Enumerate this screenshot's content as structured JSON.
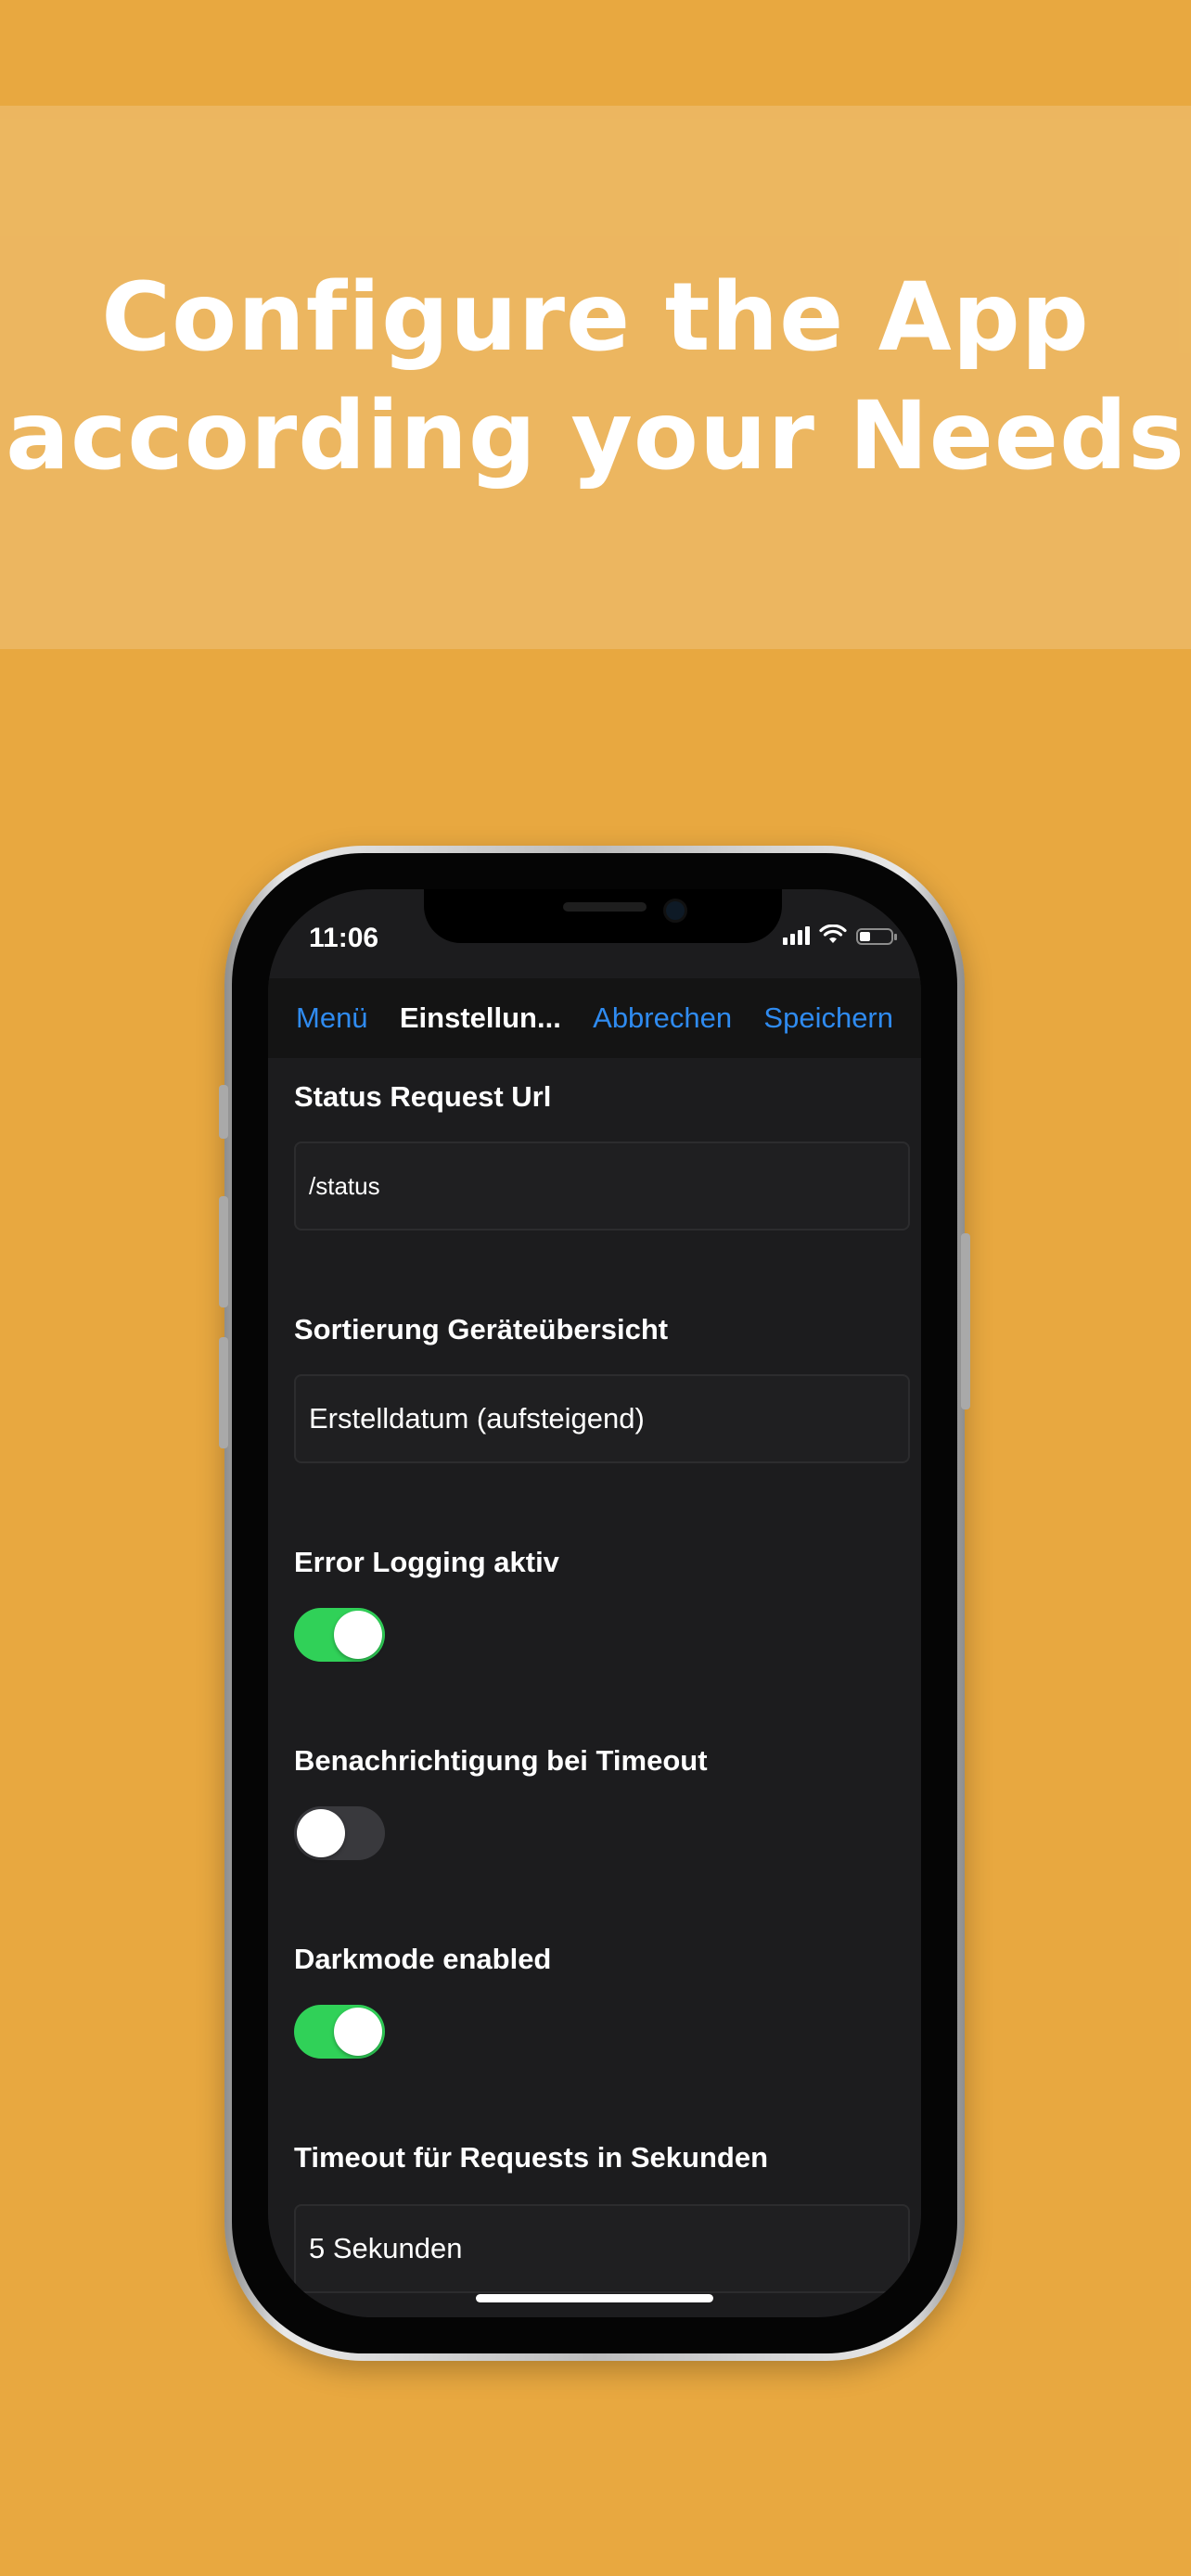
{
  "banner": {
    "line1": "Configure the App",
    "line2": "according your Needs"
  },
  "statusbar": {
    "time": "11:06"
  },
  "navbar": {
    "back_label": "Menü",
    "title": "Einstellun...",
    "cancel_label": "Abbrechen",
    "save_label": "Speichern"
  },
  "settings": {
    "status_url": {
      "label": "Status Request Url",
      "value": "/status"
    },
    "sort": {
      "label": "Sortierung Geräteübersicht",
      "value": "Erstelldatum (aufsteigend)"
    },
    "error_logging": {
      "label": "Error Logging aktiv",
      "on": true
    },
    "timeout_notification": {
      "label": "Benachrichtigung bei Timeout",
      "on": false
    },
    "darkmode": {
      "label": "Darkmode enabled",
      "on": true
    },
    "timeout": {
      "label": "Timeout für Requests in Sekunden",
      "value": "5 Sekunden"
    }
  },
  "colors": {
    "background": "#E8A840",
    "accent": "#2F8BF0",
    "toggle_on": "#30D158",
    "toggle_off": "#39393D"
  }
}
